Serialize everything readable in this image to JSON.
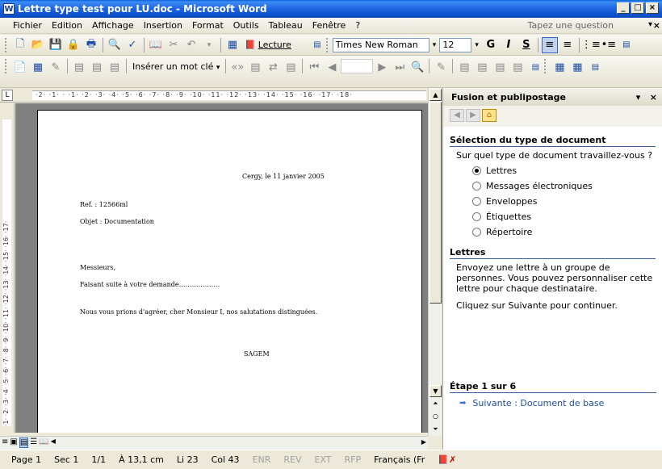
{
  "window": {
    "title": "Lettre type test pour LU.doc - Microsoft Word",
    "controls": [
      "_",
      "□",
      "×"
    ]
  },
  "menu": {
    "items": [
      {
        "label": "Fichier",
        "accel": "F"
      },
      {
        "label": "Edition",
        "accel": "E"
      },
      {
        "label": "Affichage",
        "accel": "A"
      },
      {
        "label": "Insertion",
        "accel": "I"
      },
      {
        "label": "Format",
        "accel": ""
      },
      {
        "label": "Outils",
        "accel": "O"
      },
      {
        "label": "Tableau",
        "accel": ""
      },
      {
        "label": "Fenêtre",
        "accel": ""
      },
      {
        "label": "?",
        "accel": ""
      }
    ],
    "help_placeholder": "Tapez une question"
  },
  "toolbar1": {
    "lecture_label": "Lecture",
    "font_name": "Times New Roman",
    "font_size": "12",
    "bold": "G",
    "italic": "I",
    "underline": "S"
  },
  "toolbar2": {
    "insert_field_label": "Insérer un mot clé"
  },
  "ruler": {
    "ticks": "·2· ·1· · ·1· ·2· ·3· ·4· ·5· ·6· ·7· ·8· ·9· ·10· ·11· ·12· ·13· ·14· ·15· ·16· ·17· ·18·",
    "vticks": "·1· ·2· ·3· ·4· ·5· ·6· ·7· ·8· ·9· ·10· ·11· ·12· ·13· ·14· ·15· ·16· ·17·"
  },
  "document": {
    "date": "Cergy, le 11 janvier 2005",
    "ref": "Ref. : 12566ml",
    "objet": "Objet : Documentation",
    "salutation": "Messieurs,",
    "body1": "Faisant suite à votre demande……………….",
    "closing": "Nous vous prions d'agréer, cher Monsieur I, nos salutations distinguées.",
    "signature": "SAGEM"
  },
  "status": {
    "page": "Page 1",
    "section": "Sec 1",
    "pages": "1/1",
    "position": "À 13,1 cm",
    "line": "Li 23",
    "column": "Col 43",
    "enr": "ENR",
    "rev": "REV",
    "ext": "EXT",
    "rfp": "RFP",
    "language": "Français (Fr"
  },
  "pane": {
    "title": "Fusion et publipostage",
    "section_title": "Sélection du type de document",
    "question": "Sur quel type de document travaillez-vous ?",
    "options": [
      {
        "label": "Lettres",
        "selected": true
      },
      {
        "label": "Messages électroniques",
        "selected": false
      },
      {
        "label": "Enveloppes",
        "selected": false
      },
      {
        "label": "Étiquettes",
        "selected": false
      },
      {
        "label": "Répertoire",
        "selected": false
      }
    ],
    "info_title": "Lettres",
    "info_text": "Envoyez une lettre à un groupe de personnes. Vous pouvez personnaliser cette lettre pour chaque destinataire.",
    "info_hint": "Cliquez sur Suivante pour continuer.",
    "step_label": "Étape 1 sur 6",
    "next_label": "Suivante : Document de base"
  },
  "colors": {
    "titlebar": "#0a4fc6",
    "link": "#1f4ea5",
    "section_rule": "#3a5a9a"
  }
}
